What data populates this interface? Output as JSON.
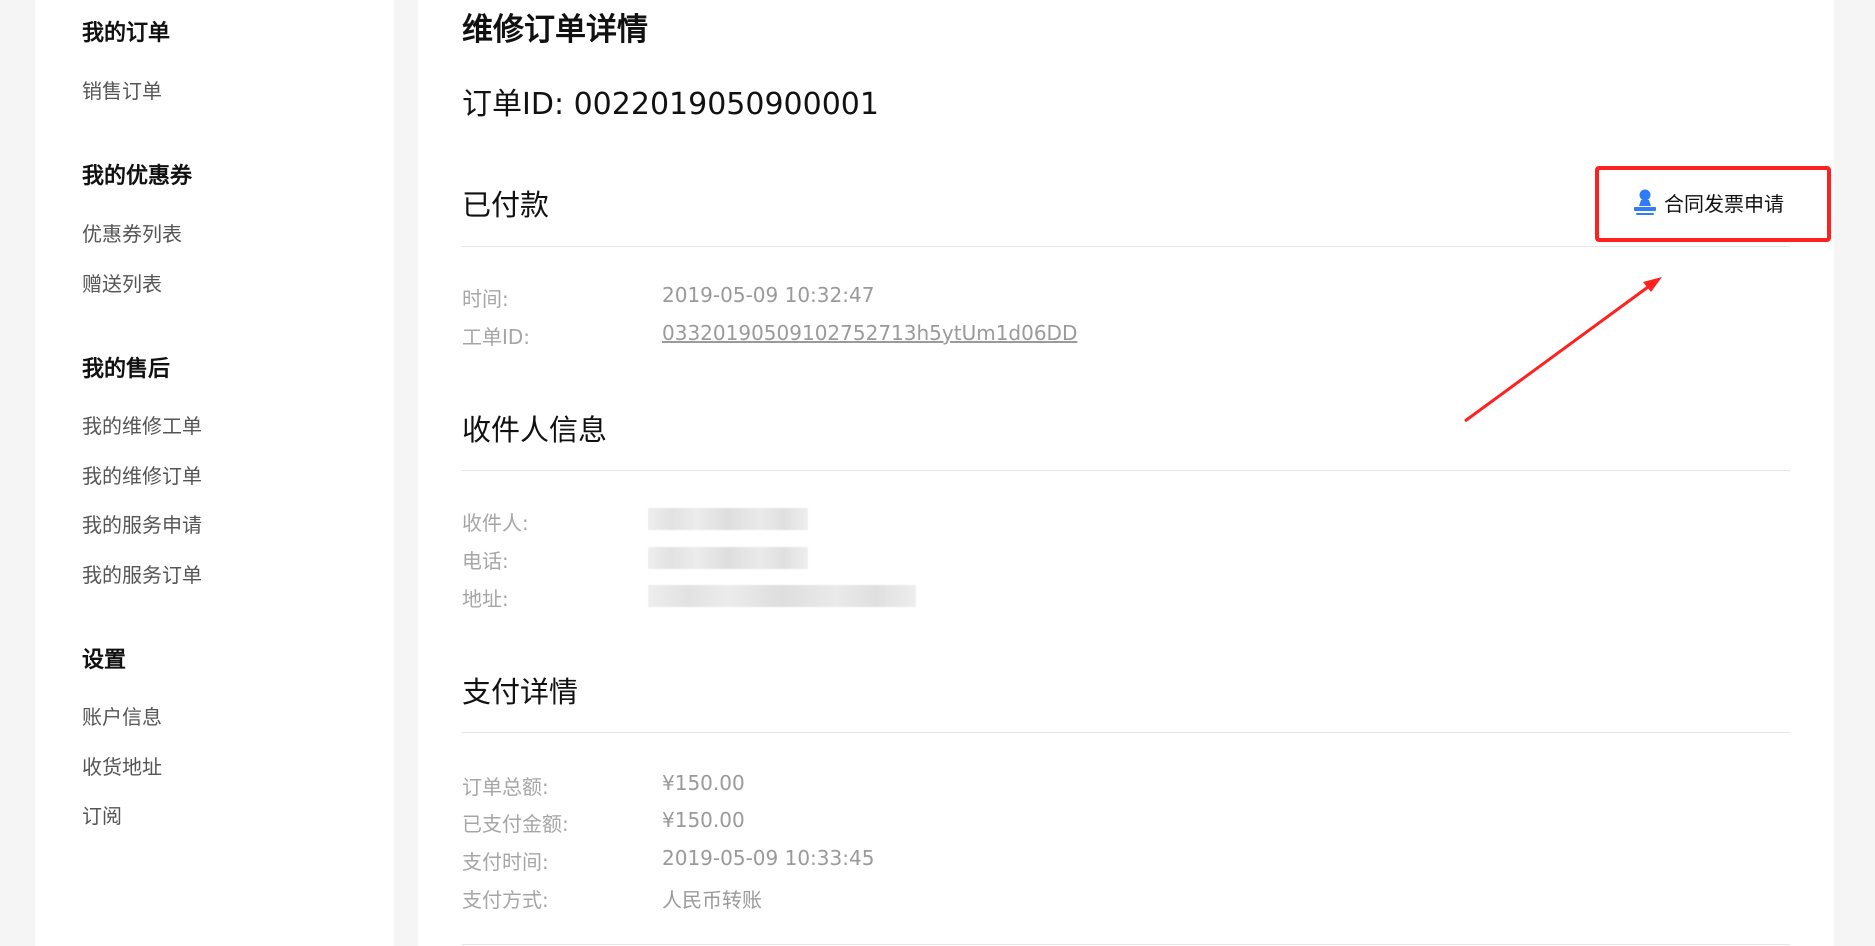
{
  "sidebar": {
    "sections": [
      {
        "title": "我的订单",
        "items": [
          "销售订单"
        ]
      },
      {
        "title": "我的优惠券",
        "items": [
          "优惠券列表",
          "赠送列表"
        ]
      },
      {
        "title": "我的售后",
        "items": [
          "我的维修工单",
          "我的维修订单",
          "我的服务申请",
          "我的服务订单"
        ]
      },
      {
        "title": "设置",
        "items": [
          "账户信息",
          "收货地址",
          "订阅"
        ]
      }
    ]
  },
  "main": {
    "page_title": "维修订单详情",
    "order_id": "订单ID: 0022019050900001",
    "status_section": {
      "title": "已付款",
      "invoice_button_label": "合同发票申请",
      "invoice_icon": "user-stamp-icon",
      "rows": [
        {
          "label": "时间:",
          "value": "2019-05-09 10:32:47"
        },
        {
          "label": "工单ID:",
          "value": "03320190509102752713h5ytUm1d06DD"
        }
      ]
    },
    "recipient_section": {
      "title": "收件人信息",
      "rows": [
        {
          "label": "收件人:"
        },
        {
          "label": "电话:"
        },
        {
          "label": "地址:"
        }
      ]
    },
    "payment_section": {
      "title": "支付详情",
      "rows": [
        {
          "label": "订单总额:",
          "value": "¥150.00"
        },
        {
          "label": "已支付金额:",
          "value": "¥150.00"
        },
        {
          "label": "支付时间:",
          "value": "2019-05-09 10:33:45"
        },
        {
          "label": "支付方式:",
          "value": "人民币转账"
        }
      ]
    }
  },
  "colors": {
    "highlight": "#ff2020",
    "icon_blue": "#2f7cf6",
    "label_gray": "#a6a6a6"
  }
}
